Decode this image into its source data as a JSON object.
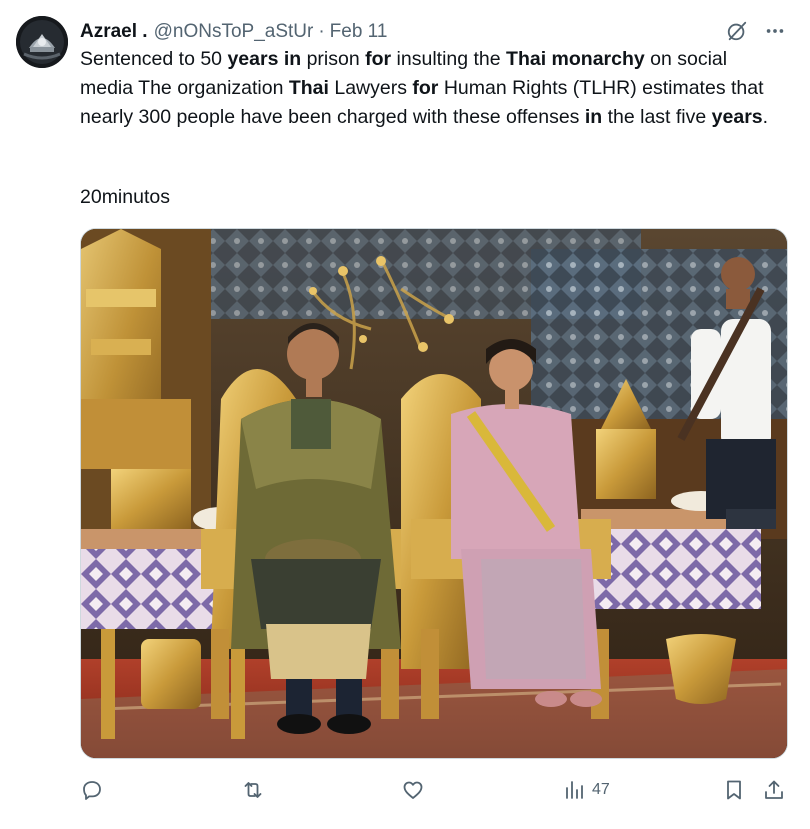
{
  "author": {
    "display_name": "Azrael .",
    "handle": "@nONsToP_aStUr",
    "separator": "·",
    "date": "Feb 11"
  },
  "tweet": {
    "segments": [
      {
        "text": "Sentenced to 50 ",
        "bold": false
      },
      {
        "text": "years in",
        "bold": true
      },
      {
        "text": " prison ",
        "bold": false
      },
      {
        "text": "for",
        "bold": true
      },
      {
        "text": " insulting the ",
        "bold": false
      },
      {
        "text": "Thai monarchy",
        "bold": true
      },
      {
        "text": " on social media The organization ",
        "bold": false
      },
      {
        "text": "Thai",
        "bold": true
      },
      {
        "text": " Lawyers ",
        "bold": false
      },
      {
        "text": "for",
        "bold": true
      },
      {
        "text": " Human Rights (TLHR) estimates that nearly 300 people have been charged with these offenses ",
        "bold": false
      },
      {
        "text": "in",
        "bold": true
      },
      {
        "text": " the last five ",
        "bold": false
      },
      {
        "text": "years",
        "bold": true
      },
      {
        "text": ".",
        "bold": false
      }
    ],
    "source": "20minutos"
  },
  "stats": {
    "views": "47"
  },
  "icons": {
    "avatar": "avatar-image",
    "grok": "grok-icon",
    "more": "more-icon",
    "reply": "reply-icon",
    "retweet": "retweet-icon",
    "like": "like-icon",
    "views": "views-icon",
    "bookmark": "bookmark-icon",
    "share": "share-icon"
  },
  "colors": {
    "text": "#0f1419",
    "secondary": "#536471",
    "border": "#cfd9de"
  }
}
